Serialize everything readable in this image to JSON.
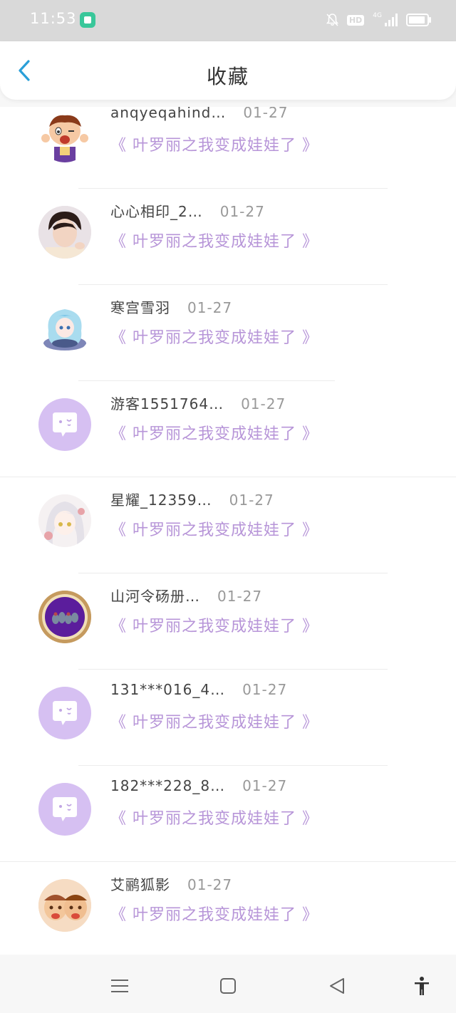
{
  "status_bar": {
    "time": "11:53",
    "network": "4G",
    "hd": "HD"
  },
  "header": {
    "title": "收藏",
    "back_icon": "chevron-left-icon"
  },
  "items": [
    {
      "username": "anqyeqahind…",
      "date": "01-27",
      "title": "《 叶罗丽之我变成娃娃了 》",
      "avatar": "cartoon-boy"
    },
    {
      "username": "心心相印_2…",
      "date": "01-27",
      "title": "《 叶罗丽之我变成娃娃了 》",
      "avatar": "photo-portrait"
    },
    {
      "username": "寒宫雪羽",
      "date": "01-27",
      "title": "《 叶罗丽之我变成娃娃了 》",
      "avatar": "anime-blue"
    },
    {
      "username": "游客1551764…",
      "date": "01-27",
      "title": "《 叶罗丽之我变成娃娃了 》",
      "avatar": "default-chat"
    },
    {
      "username": "星耀_12359…",
      "date": "01-27",
      "title": "《 叶罗丽之我变成娃娃了 》",
      "avatar": "anime-white"
    },
    {
      "username": "山河令砀册…",
      "date": "01-27",
      "title": "《 叶罗丽之我变成娃娃了 》",
      "avatar": "badge-purple"
    },
    {
      "username": "131***016_4…",
      "date": "01-27",
      "title": "《 叶罗丽之我变成娃娃了 》",
      "avatar": "default-chat"
    },
    {
      "username": "182***228_8…",
      "date": "01-27",
      "title": "《 叶罗丽之我变成娃娃了 》",
      "avatar": "default-chat"
    },
    {
      "username": "艾鹂狐影",
      "date": "01-27",
      "title": "《 叶罗丽之我变成娃娃了 》",
      "avatar": "cartoon-faces"
    }
  ],
  "nav": {
    "icons": [
      "menu-icon",
      "home-square-icon",
      "back-triangle-icon",
      "accessibility-icon"
    ]
  },
  "colors": {
    "accent": "#2a9fd8",
    "title_purple": "#b795d8",
    "avatar_purple": "#d6c0f2"
  }
}
